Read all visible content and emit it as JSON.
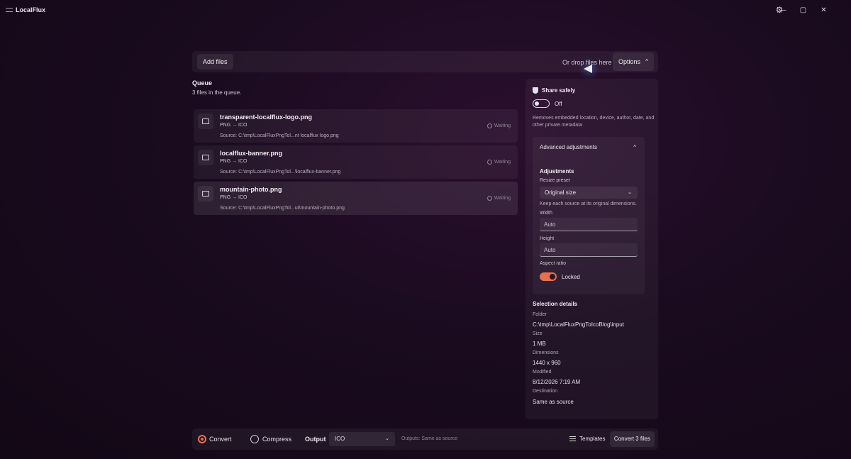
{
  "app": {
    "title": "LocalFlux"
  },
  "window": {
    "minimize": "—",
    "maximize": "▢",
    "close": "✕",
    "settings": "⚙"
  },
  "topbar": {
    "add_files": "Add files",
    "drop_hint": "Or drop files here",
    "options": "Options",
    "options_chev": "^"
  },
  "queue": {
    "title": "Queue",
    "count": "3 files in the queue.",
    "items": [
      {
        "name": "transparent-localflux-logo.png",
        "conversion": "PNG → ICO",
        "source": "Source:  C:\\tmp\\LocalFluxPngTol...nt localflux logo.png",
        "status": "Waiting"
      },
      {
        "name": "localflux-banner.png",
        "conversion": "PNG  → ICO",
        "source": "Source:  C:\\tmp\\LocalFluxPngTol...\\localflux-banner.png",
        "status": "Waiting"
      },
      {
        "name": "mountain-photo.png",
        "conversion": "PNG → ICO",
        "source": "Source:  C:\\tmp\\LocalFluxPngTol...ut\\mountain-photo.png",
        "status": "Waiting"
      }
    ]
  },
  "panel": {
    "share_title": "Share safely",
    "share_toggle": "Off",
    "share_desc": "Removes embedded location, device, author, date, and other private metadata",
    "advanced": "Advanced adjustments",
    "adv_chev": "^",
    "adjustments": "Adjustments",
    "resize_label": "Resize preset",
    "resize_value": "Original size",
    "resize_chev": "⌄",
    "resize_hint": "Keep each source at its original dimensions.",
    "width_label": "Width",
    "width_value": "Auto",
    "height_label": "Height",
    "height_value": "Auto",
    "aspect_label": "Aspect ratio",
    "aspect_value": "Locked",
    "selection_title": "Selection details",
    "details": [
      {
        "label": "Folder",
        "value": "C:\\tmp\\LocalFluxPngToIcoBlog\\input"
      },
      {
        "label": "Size",
        "value": "1 MB"
      },
      {
        "label": "Dimensions",
        "value": "1440 x 960"
      },
      {
        "label": "Modified",
        "value": "8/12/2026 7:19 AM"
      },
      {
        "label": "Destination",
        "value": "Same as source"
      }
    ]
  },
  "bottombar": {
    "convert": "Convert",
    "compress": "Compress",
    "output_label": "Output",
    "output_value": "ICO",
    "output_chev": "⌄",
    "outputs_hint": "Outputs: Same as source",
    "templates": "Templates",
    "convert_button": "Convert 3 files"
  },
  "colors": {
    "accent": "#e5714f",
    "background": "#1a0b1f"
  }
}
